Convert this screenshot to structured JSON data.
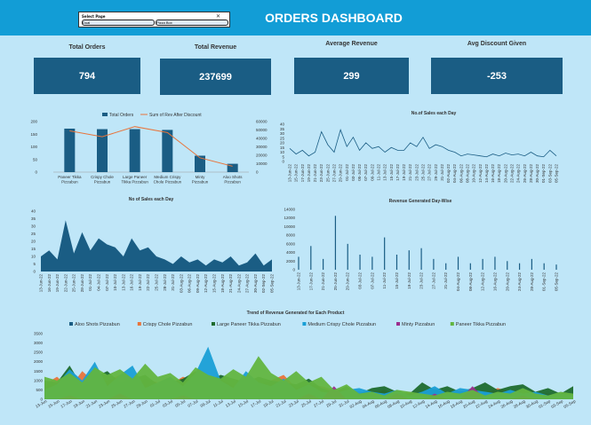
{
  "header": {
    "title": "ORDERS DASHBOARD"
  },
  "slicer": {
    "row1": "Select Page",
    "btn1": "Dual",
    "btn2": "Pizza Box"
  },
  "kpis": [
    {
      "label": "Total Orders",
      "value": "794"
    },
    {
      "label": "Total Revenue",
      "value": "237699"
    },
    {
      "label": "Average Revenue",
      "value": "299"
    },
    {
      "label": "Avg Discount Given",
      "value": "-253"
    }
  ],
  "colors": {
    "header": "#129dd6",
    "kpi": "#1a5d84",
    "bar": "#1a5d84",
    "line": "#e8743b"
  },
  "chart_data": [
    {
      "type": "bar",
      "categories": [
        "Paneer Tikka Pizzabun",
        "Crispy Chole Pizzabun",
        "Large Paneer Tikka Pizzabun",
        "Medium Crispy Chole Pizzabun",
        "Minty Pizzabun",
        "Aloo Shots Pizzabun"
      ],
      "series": [
        {
          "name": "Total Orders",
          "values": [
            172,
            170,
            170,
            167,
            65,
            33
          ]
        },
        {
          "name": "Sum of Rev After Discount",
          "values": [
            49000,
            42000,
            54000,
            47000,
            17000,
            7000
          ]
        }
      ],
      "ylim": [
        0,
        200
      ],
      "ylim2": [
        0,
        60000
      ],
      "yticks": [
        "0",
        "50",
        "100",
        "150",
        "200"
      ],
      "yticks2": [
        "0",
        "10000",
        "20000",
        "30000",
        "40000",
        "50000",
        "60000"
      ]
    },
    {
      "type": "line",
      "title": "No.of Sales each Day",
      "ylim": [
        0,
        40
      ],
      "yticks": [
        "0",
        "5",
        "10",
        "15",
        "20",
        "25",
        "30",
        "35",
        "40"
      ],
      "x": [
        "13-Jun-22",
        "15-Jun-22",
        "17-Jun-22",
        "19-Jun-22",
        "21-Jun-22",
        "23-Jun-22",
        "25-Jun-22",
        "27-Jun-22",
        "29-Jun-22",
        "01-Jul-22",
        "03-Jul-22",
        "05-Jul-22",
        "07-Jul-22",
        "09-Jul-22",
        "11-Jul-22",
        "13-Jul-22",
        "15-Jul-22",
        "17-Jul-22",
        "19-Jul-22",
        "21-Jul-22",
        "23-Jul-22",
        "25-Jul-22",
        "27-Jul-22",
        "29-Jul-22",
        "31-Jul-22",
        "02-Aug-22",
        "04-Aug-22",
        "06-Aug-22",
        "08-Aug-22",
        "10-Aug-22",
        "12-Aug-22",
        "14-Aug-22",
        "16-Aug-22",
        "18-Aug-22",
        "20-Aug-22",
        "22-Aug-22",
        "24-Aug-22",
        "26-Aug-22",
        "28-Aug-22",
        "30-Aug-22",
        "01-Sep-22",
        "03-Sep-22",
        "05-Sep-22"
      ],
      "values": [
        14,
        8,
        12,
        6,
        10,
        32,
        18,
        10,
        34,
        16,
        26,
        12,
        20,
        14,
        16,
        10,
        15,
        12,
        12,
        20,
        16,
        26,
        14,
        18,
        16,
        12,
        10,
        6,
        8,
        7,
        6,
        5,
        8,
        6,
        9,
        7,
        8,
        6,
        10,
        6,
        5,
        12,
        6
      ]
    },
    {
      "type": "area",
      "title": "No of Sales each Day",
      "ylim": [
        0,
        40
      ],
      "yticks": [
        "0",
        "5",
        "10",
        "15",
        "20",
        "25",
        "30",
        "35",
        "40"
      ],
      "x": [
        "13-Jun-22",
        "16-Jun-22",
        "19-Jun-22",
        "22-Jun-22",
        "25-Jun-22",
        "28-Jun-22",
        "01-Jul-22",
        "04-Jul-22",
        "07-Jul-22",
        "10-Jul-22",
        "13-Jul-22",
        "16-Jul-22",
        "19-Jul-22",
        "22-Jul-22",
        "25-Jul-22",
        "28-Jul-22",
        "31-Jul-22",
        "03-Aug-22",
        "06-Aug-22",
        "09-Aug-22",
        "12-Aug-22",
        "15-Aug-22",
        "18-Aug-22",
        "21-Aug-22",
        "24-Aug-22",
        "27-Aug-22",
        "30-Aug-22",
        "02-Sep-22",
        "05-Sep-22"
      ],
      "values": [
        10,
        14,
        8,
        34,
        12,
        26,
        14,
        22,
        18,
        16,
        10,
        22,
        14,
        16,
        10,
        8,
        5,
        10,
        6,
        8,
        4,
        8,
        6,
        10,
        4,
        6,
        12,
        4,
        8
      ]
    },
    {
      "type": "bar",
      "title": "Revenue Generated Day-Wise",
      "ylim": [
        0,
        14000
      ],
      "yticks": [
        "0",
        "2000",
        "4000",
        "6000",
        "8000",
        "10000",
        "12000",
        "14000"
      ],
      "x": [
        "13-Jun-22",
        "17-Jun-22",
        "21-Jun-22",
        "25-Jun-22",
        "29-Jun-22",
        "03-Jul-22",
        "07-Jul-22",
        "11-Jul-22",
        "15-Jul-22",
        "19-Jul-22",
        "23-Jul-22",
        "27-Jul-22",
        "31-Jul-22",
        "04-Aug-22",
        "08-Aug-22",
        "12-Aug-22",
        "16-Aug-22",
        "20-Aug-22",
        "24-Aug-22",
        "28-Aug-22",
        "01-Sep-22",
        "05-Sep-22"
      ],
      "values": [
        3000,
        5500,
        2500,
        12500,
        6000,
        3500,
        3000,
        7500,
        3500,
        4500,
        5000,
        2500,
        1500,
        3000,
        1500,
        2500,
        3000,
        2000,
        1500,
        2500,
        1500,
        1200
      ]
    },
    {
      "type": "area",
      "title": "Trend of Revenue Generated for Each Product",
      "ylim": [
        0,
        3500
      ],
      "yticks": [
        "0",
        "500",
        "1000",
        "1500",
        "2000",
        "2500",
        "3000",
        "3500"
      ],
      "x": [
        "13-Jun",
        "15-Jun",
        "17-Jun",
        "19-Jun",
        "21-Jun",
        "23-Jun",
        "25-Jun",
        "27-Jun",
        "29-Jun",
        "01-Jul",
        "03-Jul",
        "05-Jul",
        "07-Jul",
        "09-Jul",
        "11-Jul",
        "13-Jul",
        "15-Jul",
        "17-Jul",
        "19-Jul",
        "21-Jul",
        "23-Jul",
        "25-Jul",
        "27-Jul",
        "29-Jul",
        "31-Jul",
        "02-Aug",
        "04-Aug",
        "06-Aug",
        "08-Aug",
        "10-Aug",
        "12-Aug",
        "14-Aug",
        "16-Aug",
        "18-Aug",
        "20-Aug",
        "22-Aug",
        "24-Aug",
        "26-Aug",
        "28-Aug",
        "30-Aug",
        "01-Sep",
        "03-Sep",
        "05-Sep"
      ],
      "series": [
        {
          "name": "Aloo Shots Pizzabun",
          "color": "#1a5d84",
          "values": [
            0,
            0,
            0,
            0,
            0,
            0,
            0,
            0,
            0,
            0,
            0,
            0,
            0,
            0,
            0,
            0,
            0,
            0,
            0,
            0,
            0,
            0,
            0,
            0,
            0,
            400,
            0,
            300,
            0,
            250,
            0,
            0,
            300,
            0,
            0,
            0,
            0,
            300,
            0,
            0,
            0,
            0,
            0
          ]
        },
        {
          "name": "Crispy Chole Pizzabun",
          "color": "#e8743b",
          "values": [
            800,
            1200,
            600,
            1500,
            900,
            1000,
            1300,
            700,
            1100,
            900,
            800,
            1200,
            1000,
            900,
            1100,
            700,
            900,
            800,
            1000,
            1300,
            600,
            800,
            700,
            500,
            600,
            400,
            300,
            500,
            200,
            400,
            300,
            600,
            300,
            500,
            400,
            300,
            600,
            400,
            200,
            300,
            300,
            200,
            300
          ]
        },
        {
          "name": "Large Paneer Tikka Pizzabun",
          "color": "#1e6b2e",
          "values": [
            1000,
            900,
            1800,
            700,
            1200,
            1500,
            900,
            1100,
            1300,
            800,
            900,
            1100,
            1500,
            1000,
            1300,
            1100,
            900,
            1200,
            1000,
            900,
            800,
            1100,
            600,
            400,
            700,
            300,
            600,
            700,
            400,
            300,
            900,
            500,
            700,
            400,
            600,
            900,
            500,
            700,
            800,
            400,
            600,
            300,
            700
          ]
        },
        {
          "name": "Medium Crispy Chole Pizzabun",
          "color": "#1a9fd6",
          "values": [
            500,
            800,
            1600,
            1000,
            2000,
            700,
            1300,
            1800,
            600,
            900,
            1200,
            700,
            1400,
            2800,
            1000,
            600,
            1500,
            900,
            700,
            1100,
            500,
            800,
            400,
            300,
            500,
            600,
            400,
            300,
            500,
            200,
            400,
            700,
            300,
            600,
            500,
            400,
            300,
            500,
            300,
            400,
            200,
            300,
            200
          ]
        },
        {
          "name": "Minty Pizzabun",
          "color": "#9b2f8e",
          "values": [
            0,
            0,
            200,
            0,
            0,
            0,
            300,
            0,
            0,
            0,
            0,
            200,
            0,
            0,
            0,
            0,
            0,
            0,
            0,
            0,
            0,
            300,
            0,
            700,
            0,
            0,
            0,
            0,
            300,
            0,
            0,
            300,
            0,
            0,
            700,
            0,
            0,
            0,
            200,
            0,
            0,
            0,
            0
          ]
        },
        {
          "name": "Paneer Tikka Pizzabun",
          "color": "#62b540",
          "values": [
            1200,
            1000,
            1400,
            900,
            1700,
            1300,
            1600,
            1100,
            1900,
            1200,
            1400,
            900,
            1700,
            1300,
            1100,
            1600,
            1200,
            2300,
            1400,
            1000,
            1500,
            900,
            1200,
            500,
            800,
            300,
            400,
            200,
            500,
            400,
            300,
            200,
            400,
            300,
            500,
            200,
            400,
            300,
            600,
            300,
            200,
            400,
            300
          ]
        }
      ]
    }
  ]
}
